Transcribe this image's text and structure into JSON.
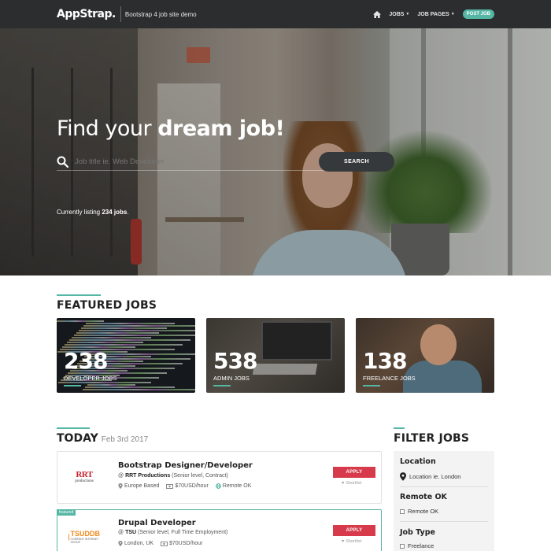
{
  "nav": {
    "brand": "AppStrap.",
    "tagline": "Bootstrap 4 job site demo",
    "jobs_label": "JOBS",
    "job_pages_label": "JOB PAGES",
    "post_job_label": "POST JOB"
  },
  "hero": {
    "title_regular": "Find your ",
    "title_bold": "dream job!",
    "search_placeholder": "Job title ie. Web Developer",
    "search_button": "SEARCH",
    "listing_prefix": "Currently listing ",
    "listing_count": "234 jobs",
    "listing_suffix": "."
  },
  "featured": {
    "title": "FEATURED JOBS",
    "cards": [
      {
        "count": "238",
        "label": "DEVELOPER JOBS"
      },
      {
        "count": "538",
        "label": "ADMIN JOBS"
      },
      {
        "count": "138",
        "label": "FREELANCE JOBS"
      }
    ]
  },
  "today": {
    "title": "TODAY",
    "date": "Feb 3rd 2017",
    "jobs": [
      {
        "title": "Bootstrap Designer/Developer",
        "company_prefix": "@ ",
        "company": "RRT Productions",
        "company_detail": " (Senior level, Contract)",
        "location": "Europe Based",
        "salary": "$70USD/hour",
        "remote": "Remote OK",
        "apply": "APPLY",
        "shortlist": "Shortlist",
        "logo_big": "RRT",
        "logo_small": "productions",
        "featured": false
      },
      {
        "badge": "featured",
        "title": "Drupal Developer",
        "company_prefix": "@ ",
        "company": "TSU",
        "company_detail": " (Senior level, Full Time Employment)",
        "location": "London, UK",
        "salary": "$70USD/hour",
        "apply": "APPLY",
        "shortlist": "Shortlist",
        "logo_big": "TSUDDB",
        "logo_small": "COMPANY INTERNET GROUP",
        "featured": true
      }
    ]
  },
  "filter": {
    "title": "FILTER JOBS",
    "location_title": "Location",
    "location_placeholder": "Location ie. London",
    "remote_title": "Remote OK",
    "remote_option": "Remote OK",
    "jobtype_title": "Job Type",
    "jobtype_option": "Freelance"
  },
  "colors": {
    "accent": "#55b6a4",
    "apply": "#d63a4b",
    "navbar": "#2b2d2f"
  }
}
